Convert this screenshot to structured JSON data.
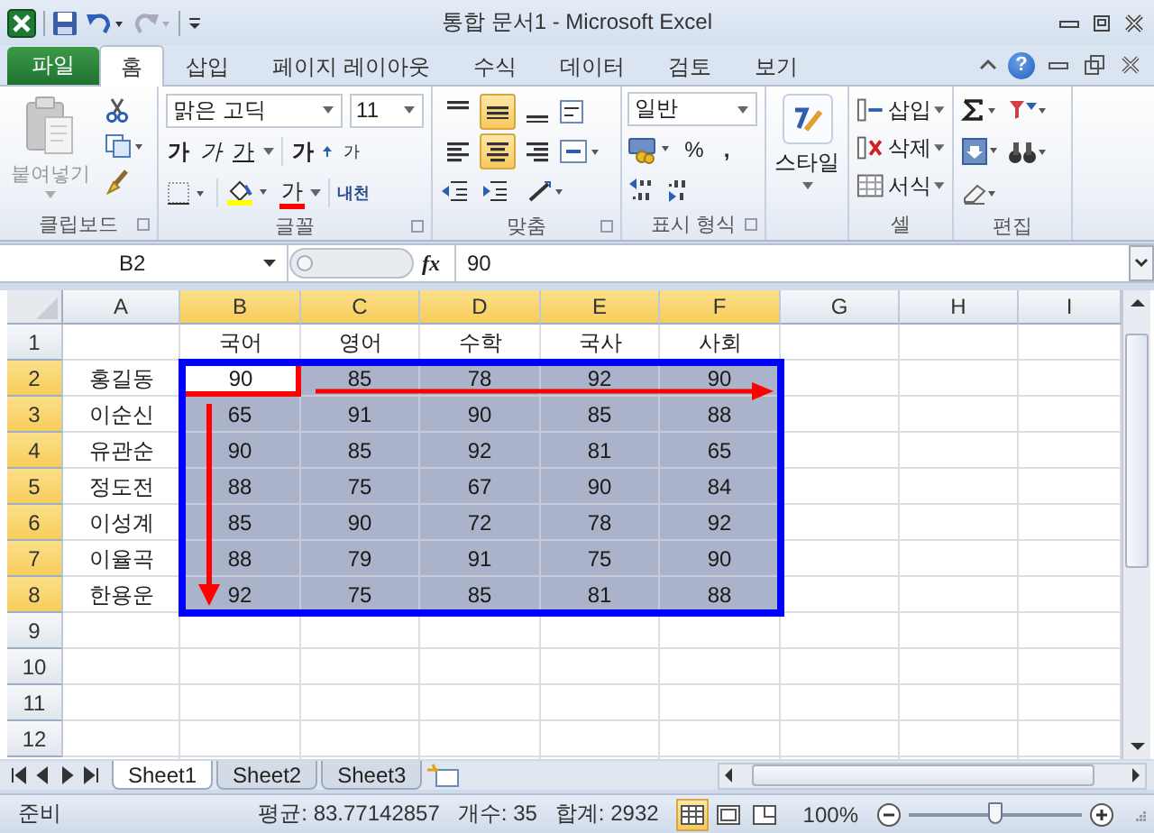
{
  "window": {
    "title": "통합 문서1 - Microsoft Excel"
  },
  "tabs": [
    {
      "label": "파일",
      "kind": "file",
      "selected": false
    },
    {
      "label": "홈",
      "kind": "tab",
      "selected": true
    },
    {
      "label": "삽입",
      "kind": "tab",
      "selected": false
    },
    {
      "label": "페이지 레이아웃",
      "kind": "tab",
      "selected": false
    },
    {
      "label": "수식",
      "kind": "tab",
      "selected": false
    },
    {
      "label": "데이터",
      "kind": "tab",
      "selected": false
    },
    {
      "label": "검토",
      "kind": "tab",
      "selected": false
    },
    {
      "label": "보기",
      "kind": "tab",
      "selected": false
    }
  ],
  "help": "?",
  "ribbon": {
    "clipboard": {
      "paste": "붙여넣기",
      "label": "클립보드"
    },
    "font": {
      "face": "맑은 고딕",
      "size": "11",
      "bold": "가",
      "italic": "가",
      "underline": "가",
      "grow": "가",
      "shrink": "가",
      "font_color": "가",
      "phonetic": "내천",
      "label": "글꼴"
    },
    "alignment": {
      "buttons": [
        {
          "kind": "top",
          "selected": false
        },
        {
          "kind": "middle",
          "selected": true
        },
        {
          "kind": "bottom",
          "selected": false
        },
        {
          "kind": "left",
          "selected": false
        },
        {
          "kind": "center",
          "selected": true
        },
        {
          "kind": "right",
          "selected": false
        }
      ],
      "label": "맞춤"
    },
    "number": {
      "format": "일반",
      "percent": "%",
      "comma": ",",
      "label": "표시 형식"
    },
    "styles": {
      "label": "스타일"
    },
    "cells": {
      "items": [
        "삽입",
        "삭제",
        "서식"
      ],
      "label": "셀"
    },
    "editing": {
      "label": "편집"
    }
  },
  "formula_bar": {
    "name_box": "B2",
    "function_label": "fx",
    "value": "90"
  },
  "sheet": {
    "columns": [
      {
        "label": "A",
        "selected": false
      },
      {
        "label": "B",
        "selected": true
      },
      {
        "label": "C",
        "selected": true
      },
      {
        "label": "D",
        "selected": true
      },
      {
        "label": "E",
        "selected": true
      },
      {
        "label": "F",
        "selected": true
      },
      {
        "label": "G",
        "selected": false
      },
      {
        "label": "H",
        "selected": false
      },
      {
        "label": "I",
        "selected": false
      }
    ],
    "rows": [
      {
        "label": "1",
        "selected": false,
        "cells": [
          null,
          {
            "text": "국어",
            "selected": false,
            "active": false
          },
          {
            "text": "영어",
            "selected": false,
            "active": false
          },
          {
            "text": "수학",
            "selected": false,
            "active": false
          },
          {
            "text": "국사",
            "selected": false,
            "active": false
          },
          {
            "text": "사회",
            "selected": false,
            "active": false
          }
        ]
      },
      {
        "label": "2",
        "selected": true,
        "cells": [
          {
            "text": "홍길동",
            "selected": false,
            "active": false
          },
          {
            "text": "90",
            "selected": true,
            "active": true
          },
          {
            "text": "85",
            "selected": true,
            "active": false
          },
          {
            "text": "78",
            "selected": true,
            "active": false
          },
          {
            "text": "92",
            "selected": true,
            "active": false
          },
          {
            "text": "90",
            "selected": true,
            "active": false
          }
        ]
      },
      {
        "label": "3",
        "selected": true,
        "cells": [
          {
            "text": "이순신",
            "selected": false,
            "active": false
          },
          {
            "text": "65",
            "selected": true,
            "active": false
          },
          {
            "text": "91",
            "selected": true,
            "active": false
          },
          {
            "text": "90",
            "selected": true,
            "active": false
          },
          {
            "text": "85",
            "selected": true,
            "active": false
          },
          {
            "text": "88",
            "selected": true,
            "active": false
          }
        ]
      },
      {
        "label": "4",
        "selected": true,
        "cells": [
          {
            "text": "유관순",
            "selected": false,
            "active": false
          },
          {
            "text": "90",
            "selected": true,
            "active": false
          },
          {
            "text": "85",
            "selected": true,
            "active": false
          },
          {
            "text": "92",
            "selected": true,
            "active": false
          },
          {
            "text": "81",
            "selected": true,
            "active": false
          },
          {
            "text": "65",
            "selected": true,
            "active": false
          }
        ]
      },
      {
        "label": "5",
        "selected": true,
        "cells": [
          {
            "text": "정도전",
            "selected": false,
            "active": false
          },
          {
            "text": "88",
            "selected": true,
            "active": false
          },
          {
            "text": "75",
            "selected": true,
            "active": false
          },
          {
            "text": "67",
            "selected": true,
            "active": false
          },
          {
            "text": "90",
            "selected": true,
            "active": false
          },
          {
            "text": "84",
            "selected": true,
            "active": false
          }
        ]
      },
      {
        "label": "6",
        "selected": true,
        "cells": [
          {
            "text": "이성계",
            "selected": false,
            "active": false
          },
          {
            "text": "85",
            "selected": true,
            "active": false
          },
          {
            "text": "90",
            "selected": true,
            "active": false
          },
          {
            "text": "72",
            "selected": true,
            "active": false
          },
          {
            "text": "78",
            "selected": true,
            "active": false
          },
          {
            "text": "92",
            "selected": true,
            "active": false
          }
        ]
      },
      {
        "label": "7",
        "selected": true,
        "cells": [
          {
            "text": "이율곡",
            "selected": false,
            "active": false
          },
          {
            "text": "88",
            "selected": true,
            "active": false
          },
          {
            "text": "79",
            "selected": true,
            "active": false
          },
          {
            "text": "91",
            "selected": true,
            "active": false
          },
          {
            "text": "75",
            "selected": true,
            "active": false
          },
          {
            "text": "90",
            "selected": true,
            "active": false
          }
        ]
      },
      {
        "label": "8",
        "selected": true,
        "cells": [
          {
            "text": "한용운",
            "selected": false,
            "active": false
          },
          {
            "text": "92",
            "selected": true,
            "active": false
          },
          {
            "text": "75",
            "selected": true,
            "active": false
          },
          {
            "text": "85",
            "selected": true,
            "active": false
          },
          {
            "text": "81",
            "selected": true,
            "active": false
          },
          {
            "text": "88",
            "selected": true,
            "active": false
          }
        ]
      },
      {
        "label": "9",
        "selected": false
      },
      {
        "label": "10",
        "selected": false
      },
      {
        "label": "11",
        "selected": false
      },
      {
        "label": "12",
        "selected": false
      }
    ]
  },
  "sheet_tabs": [
    {
      "label": "Sheet1",
      "selected": true
    },
    {
      "label": "Sheet2",
      "selected": false
    },
    {
      "label": "Sheet3",
      "selected": false
    }
  ],
  "status_bar": {
    "mode": "준비",
    "average": "평균: 83.77142857",
    "count": "개수: 35",
    "sum": "합계: 2932",
    "views": [
      {
        "kind": "normal",
        "selected": true
      },
      {
        "kind": "layout",
        "selected": false
      },
      {
        "kind": "break",
        "selected": false
      }
    ],
    "zoom": "100%",
    "zoom_slider": {
      "level": 0.5
    }
  }
}
